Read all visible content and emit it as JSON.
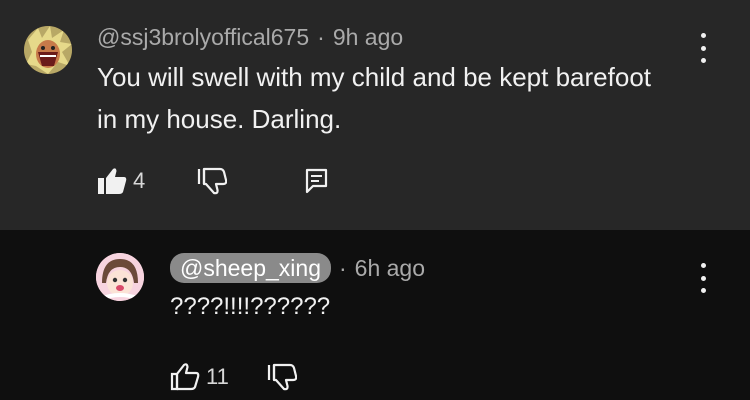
{
  "comment": {
    "handle": "@ssj3brolyoffical675",
    "time": "9h ago",
    "text": "You will swell with my child and be kept barefoot in my house. Darling.",
    "likes": "4",
    "icons": {
      "like": "thumbs-up-filled-icon",
      "dislike": "thumbs-down-outline-icon",
      "reply": "reply-comment-icon",
      "more": "more-vert-icon"
    }
  },
  "reply": {
    "handle": "@sheep_xing",
    "time": "6h ago",
    "text": "????!!!!??????",
    "likes": "11",
    "icons": {
      "like": "thumbs-up-outline-icon",
      "dislike": "thumbs-down-outline-icon",
      "more": "more-vert-icon"
    }
  },
  "separator": "·",
  "colors": {
    "top_bg": "#272727",
    "reply_bg": "#0f0f0f",
    "meta_text": "#aaaaaa",
    "pill_bg": "#8a8a8a"
  }
}
